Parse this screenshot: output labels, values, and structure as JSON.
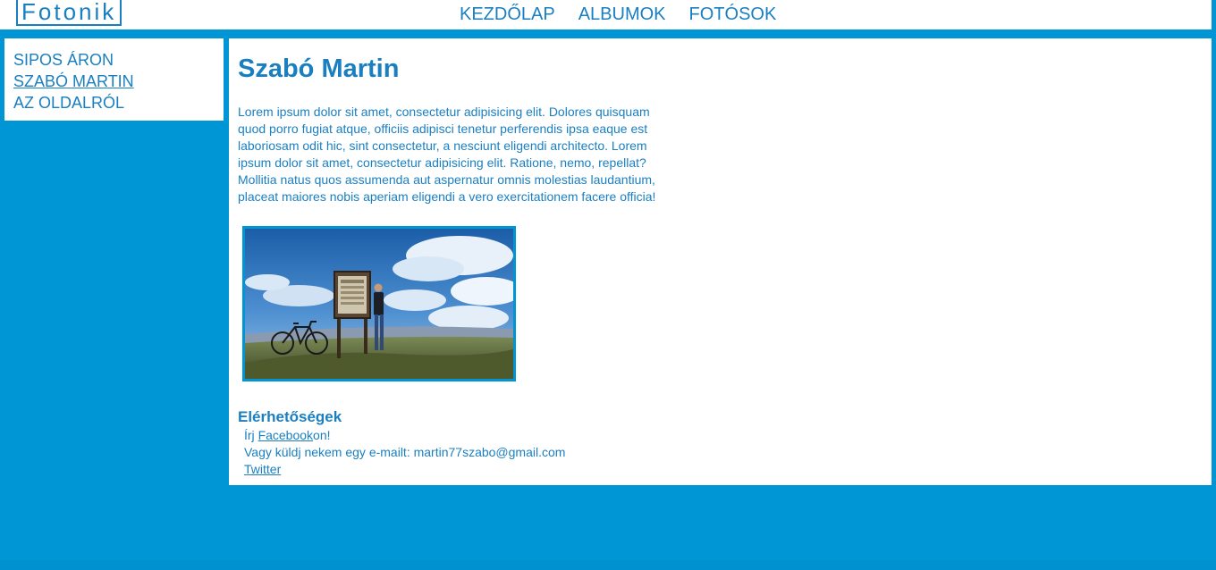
{
  "header": {
    "logo": "Fotonik",
    "nav": [
      {
        "label": "KEZDŐLAP"
      },
      {
        "label": "ALBUMOK"
      },
      {
        "label": "FOTÓSOK"
      }
    ]
  },
  "sidebar": {
    "items": [
      {
        "label": "SIPOS ÁRON",
        "active": false
      },
      {
        "label": "SZABÓ MARTIN",
        "active": true
      },
      {
        "label": "AZ OLDALRÓL",
        "active": false
      }
    ]
  },
  "main": {
    "title": "Szabó Martin",
    "intro": "Lorem ipsum dolor sit amet, consectetur adipisicing elit. Dolores quisquam quod porro fugiat atque, officiis adipisci tenetur perferendis ipsa eaque est laboriosam odit hic, sint consectetur, a nesciunt eligendi architecto. Lorem ipsum dolor sit amet, consectetur adipisicing elit. Ratione, nemo, repellat? Mollitia natus quos assumenda aut aspernatur omnis molestias laudantium, placeat maiores nobis aperiam eligendi a vero exercitationem facere officia!",
    "contacts": {
      "heading": "Elérhetőségek",
      "facebook_prefix": "Írj ",
      "facebook_link": "Facebook",
      "facebook_suffix": "on!",
      "email_line": "Vagy küldj nekem egy e-mailt: martin77szabo@gmail.com",
      "twitter_link": "Twitter"
    }
  },
  "colors": {
    "background": "#0096d6",
    "accent": "#1a7fc0",
    "panel": "#ffffff"
  }
}
